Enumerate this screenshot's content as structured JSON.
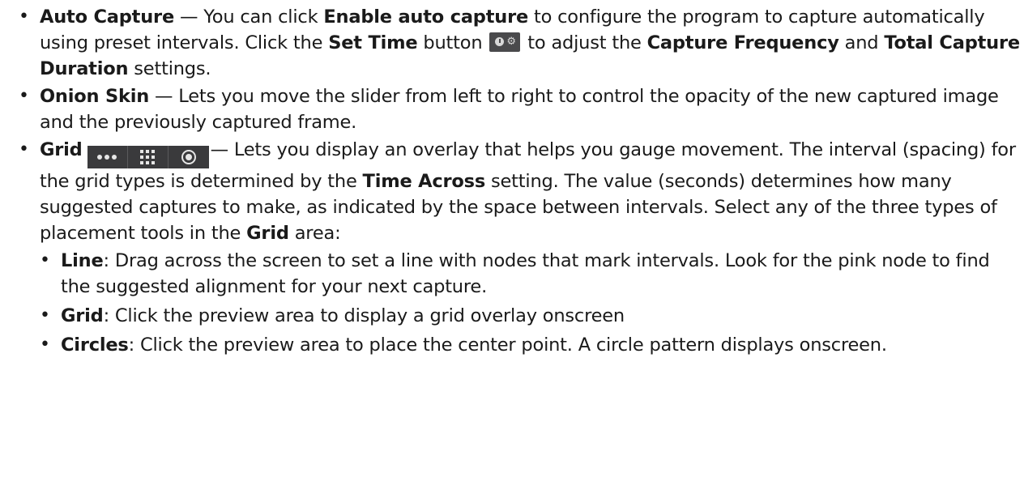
{
  "bullet_char": "•",
  "items": [
    {
      "auto_capture": {
        "title": "Auto Capture",
        "t1": " — You can click ",
        "enable_label": "Enable auto capture",
        "t2": " to configure the program to capture automatically using preset intervals. Click the ",
        "set_time_label": "Set Time",
        "t3": " button ",
        "t4": " to adjust the ",
        "capture_frequency_label": "Capture Frequency",
        "t5": " and ",
        "total_duration_label": "Total Capture Duration",
        "t6": " settings."
      }
    }
  ],
  "onion_skin": {
    "title": "Onion Skin",
    "text": " — Lets you move the slider from left to right to control the opacity of the new captured image and the previously captured frame."
  },
  "grid": {
    "title": "Grid",
    "t1": "— Lets you display an overlay that helps you gauge movement. The interval (spacing) for the grid types is determined by the ",
    "time_across_label": "Time Across",
    "t2": " setting. The value (seconds) determines how many suggested captures to make, as indicated by the space between intervals. Select any of the three types of placement tools in the ",
    "grid_area_label": "Grid",
    "t3": " area:",
    "icons": [
      "dots-icon",
      "grid-icon",
      "circles-icon"
    ],
    "sub_items": [
      {
        "label": "Line",
        "text": ": Drag across the screen to set a line with nodes that mark intervals. Look for the pink node to find the suggested alignment for your next capture."
      },
      {
        "label": "Grid",
        "text": ": Click the preview area to display a grid overlay onscreen"
      },
      {
        "label": "Circles",
        "text": ": Click the preview area to place the center point. A circle pattern displays onscreen."
      }
    ]
  },
  "colors": {
    "text": "#1a1a1a",
    "icon_bg": "#3a3a3c",
    "icon_fg": "#e6e6e6"
  }
}
